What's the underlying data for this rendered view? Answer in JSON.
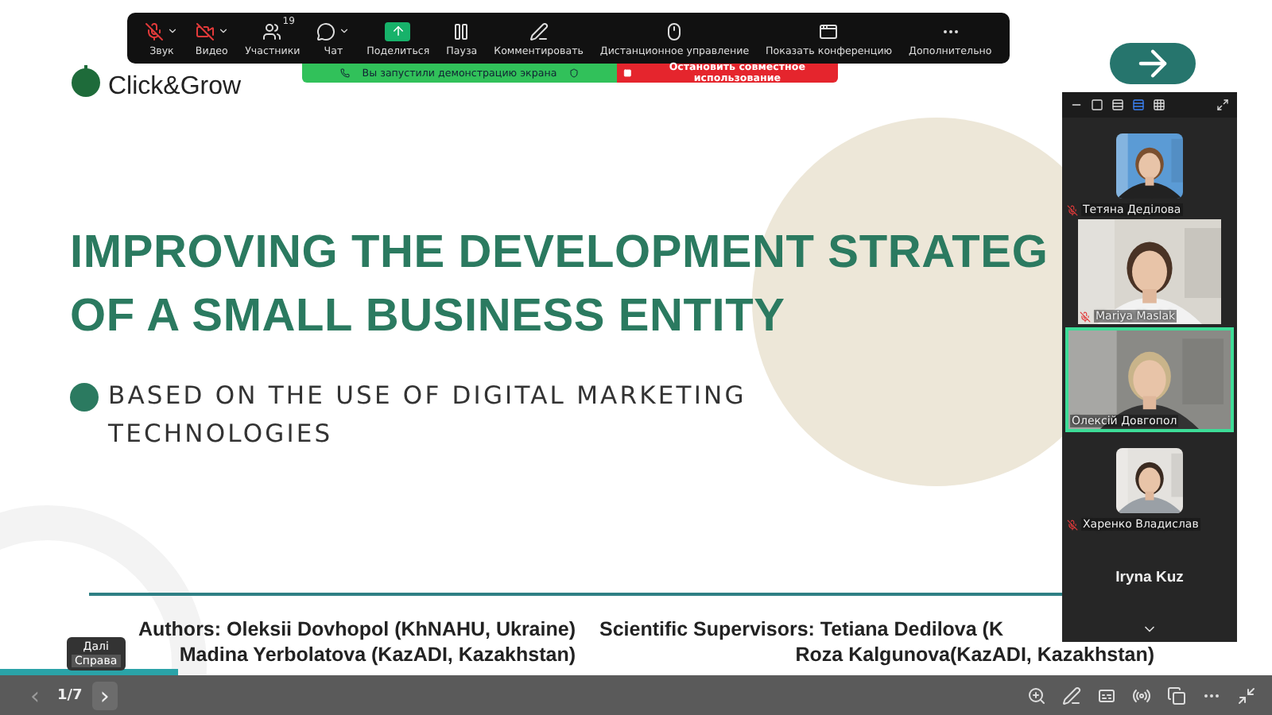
{
  "slide": {
    "logo": "Click&Grow",
    "title": [
      "IMPROVING THE DEVELOPMENT STRATEG",
      "OF A SMALL BUSINESS ENTITY"
    ],
    "subtitle": [
      "BASED ON THE USE OF DIGITAL MARKETING",
      "TECHNOLOGIES"
    ],
    "authors": [
      "Authors: Oleksii Dovhopol (KhNAHU, Ukraine)",
      "Madina Yerbolatova (KazADI, Kazakhstan)"
    ],
    "supervisors": [
      "Scientific Supervisors: Tetiana Dedilova (K",
      "Roza Kalgunova(KazADI, Kazakhstan)"
    ],
    "progress": {
      "level": 0.14
    }
  },
  "toolbar": [
    {
      "label": "Звук",
      "off": true,
      "caret": true
    },
    {
      "label": "Видео",
      "off": true,
      "caret": true
    },
    {
      "label": "Участники",
      "badge": "19"
    },
    {
      "label": "Чат",
      "caret": true
    },
    {
      "label": "Поделиться",
      "active": true
    },
    {
      "label": "Пауза"
    },
    {
      "label": "Комментировать"
    },
    {
      "label": "Дистанционное управление"
    },
    {
      "label": "Показать конференцию"
    },
    {
      "label": "Дополнительно"
    }
  ],
  "share_banner": {
    "status": "Вы запустили демонстрацию экрана",
    "stop": "Остановить совместное использование"
  },
  "participants": [
    {
      "name": "Тетяна Дедiлова",
      "muted": true,
      "speaking": false
    },
    {
      "name": "Mariya Maslak",
      "kind": "video",
      "muted": true,
      "speaking": false
    },
    {
      "name": "Олексій Довгопол",
      "kind": "video",
      "muted": false,
      "speaking": true
    },
    {
      "name": "Харенко Владислав",
      "muted": true,
      "speaking": false
    },
    {
      "name": "Iryna Kuz",
      "kind": "name"
    }
  ],
  "view_modes": [
    {
      "selected": false
    },
    {
      "selected": false
    },
    {
      "selected": true
    },
    {
      "selected": false
    }
  ],
  "bottom_bar": {
    "prev": "‹",
    "page": "1/7",
    "next": "›",
    "tooltip": [
      "Далі",
      "Справа"
    ]
  }
}
